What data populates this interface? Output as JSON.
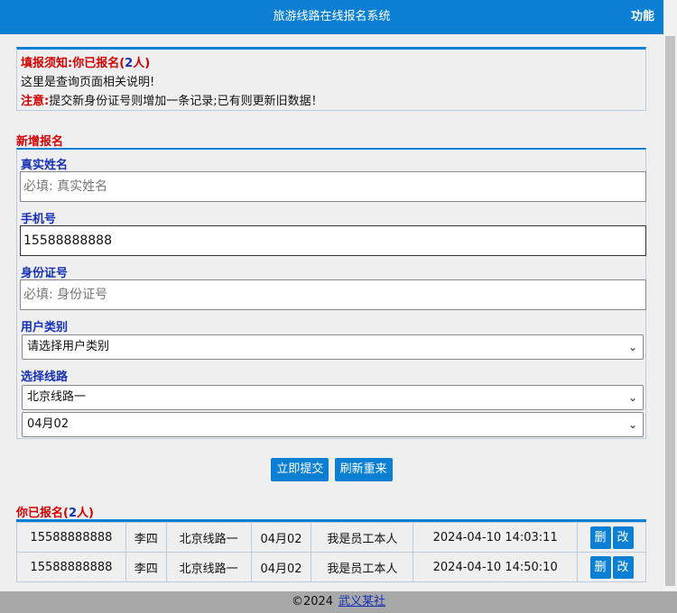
{
  "header": {
    "title": "旅游线路在线报名系统",
    "menu_label": "功能"
  },
  "notice": {
    "line1_prefix": "填报须知:你已报名(",
    "line1_count": "2",
    "line1_suffix": "人)",
    "line2": "这里是查询页面相关说明!",
    "line3_label": "注意:",
    "line3_text": "提交新身份证号则增加一条记录;已有则更新旧数据！"
  },
  "form": {
    "section_title": "新增报名",
    "name_label": "真实姓名",
    "name_placeholder": "必填: 真实姓名",
    "phone_label": "手机号",
    "phone_value": "15588888888",
    "id_label": "身份证号",
    "id_placeholder": "必填: 身份证号",
    "type_label": "用户类别",
    "type_selected": "请选择用户类别",
    "route_label": "选择线路",
    "route_selected": "北京线路一",
    "date_selected": "04月02"
  },
  "actions": {
    "submit_label": "立即提交",
    "reset_label": "刷新重来"
  },
  "list": {
    "title_prefix": "你已报名(",
    "title_count": "2",
    "title_suffix": "人)",
    "delete_label": "删",
    "edit_label": "改",
    "rows": [
      {
        "phone": "15588888888",
        "name": "李四",
        "route": "北京线路一",
        "date": "04月02",
        "type": "我是员工本人",
        "time": "2024-04-10 14:03:11"
      },
      {
        "phone": "15588888888",
        "name": "李四",
        "route": "北京线路一",
        "date": "04月02",
        "type": "我是员工本人",
        "time": "2024-04-10 14:50:10"
      }
    ]
  },
  "footer": {
    "copyright": "©2024",
    "link_text": "武义某社"
  }
}
